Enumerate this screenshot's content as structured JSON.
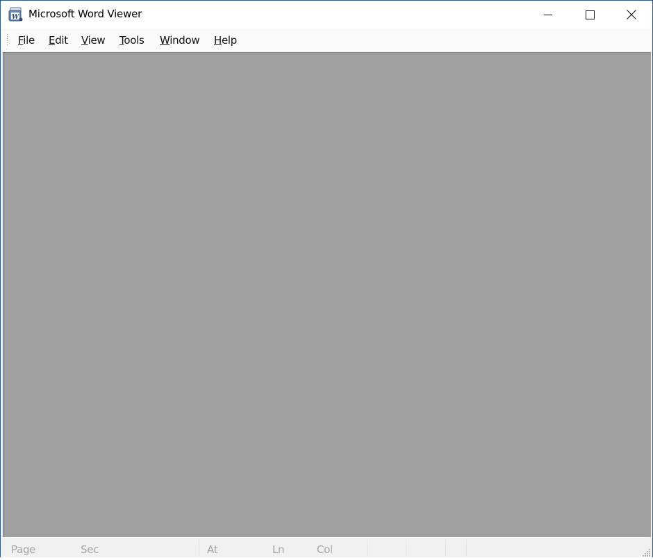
{
  "window": {
    "title": "Microsoft Word Viewer",
    "app_icon": "word-viewer-icon",
    "controls": {
      "minimize": "minimize-icon",
      "maximize": "maximize-icon",
      "close": "close-icon"
    }
  },
  "menubar": {
    "items": [
      {
        "label": "File",
        "mnemonic": "F",
        "rest": "ile"
      },
      {
        "label": "Edit",
        "mnemonic": "E",
        "rest": "dit"
      },
      {
        "label": "View",
        "mnemonic": "V",
        "rest": "iew"
      },
      {
        "label": "Tools",
        "mnemonic": "T",
        "rest": "ools"
      },
      {
        "label": "Window",
        "mnemonic": "W",
        "rest": "indow"
      },
      {
        "label": "Help",
        "mnemonic": "H",
        "rest": "elp"
      }
    ]
  },
  "workspace": {
    "background": "#a0a0a0"
  },
  "statusbar": {
    "page": "Page",
    "sec": "Sec",
    "at": "At",
    "ln": "Ln",
    "col": "Col"
  },
  "colors": {
    "window_border": "#2b5b8a",
    "status_text": "#a5a5a5"
  }
}
